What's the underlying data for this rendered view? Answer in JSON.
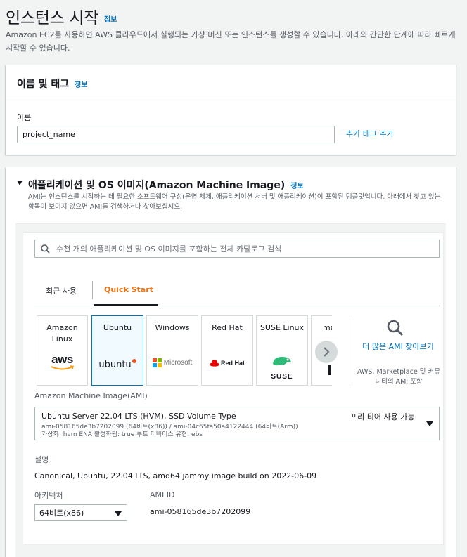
{
  "page": {
    "title": "인스턴스 시작",
    "info": "정보",
    "subtitle": "Amazon EC2를 사용하면 AWS 클라우드에서 실행되는 가상 머신 또는 인스턴스를 생성할 수 있습니다. 아래의 간단한 단계에 따라 빠르게 시작할 수 있습니다."
  },
  "name_tags": {
    "heading": "이름 및 태그",
    "info": "정보",
    "name_label": "이름",
    "name_value": "project_name",
    "add_tag_link": "추가 태그 추가"
  },
  "ami_section": {
    "heading": "애플리케이션 및 OS 이미지(Amazon Machine Image)",
    "info": "정보",
    "description": "AMI는 인스턴스를 시작하는 데 필요한 소프트웨어 구성(운영 체제, 애플리케이션 서버 및 애플리케이션)이 포함된 템플릿입니다. 아래에서 찾고 있는 항목이 보이지 않으면 AMI를 검색하거나 찾아보십시오.",
    "search_placeholder": "수천 개의 애플리케이션 및 OS 이미지를 포함하는 전체 카탈로그 검색",
    "tabs": [
      {
        "label": "최근 사용",
        "active": false
      },
      {
        "label": "Quick Start",
        "active": true
      }
    ],
    "tiles": [
      {
        "label": "Amazon\nLinux",
        "logo_text": "aws",
        "selected": false
      },
      {
        "label": "Ubuntu",
        "logo_text": "ubuntu",
        "selected": true
      },
      {
        "label": "Windows",
        "logo_text": "Microsoft",
        "selected": false
      },
      {
        "label": "Red Hat",
        "logo_text": "Red Hat",
        "selected": false
      },
      {
        "label": "SUSE Linux",
        "logo_text": "SUSE",
        "selected": false
      },
      {
        "label": "ma",
        "logo_text": "",
        "selected": false
      }
    ],
    "more_ami_link": "더 많은 AMI 찾아보기",
    "more_ami_note": "AWS, Marketplace 및 커뮤니티의 AMI 포함",
    "ami_label": "Amazon Machine Image(AMI)",
    "ami_selected": {
      "name": "Ubuntu Server 22.04 LTS (HVM), SSD Volume Type",
      "ids": "ami-058165de3b7202099 (64비트(x86)) / ami-04c65fa50a4122444 (64비트(Arm))",
      "virtualization": "가상화: hvm     ENA 활성화됨: true     루트 디바이스 유형: ebs",
      "tier": "프리 티어 사용 가능"
    },
    "description_label": "설명",
    "description_value": "Canonical, Ubuntu, 22.04 LTS, amd64 jammy image build on 2022-06-09",
    "arch_label": "아키텍처",
    "arch_value": "64비트(x86)",
    "ami_id_label": "AMI ID",
    "ami_id_value": "ami-058165de3b7202099"
  },
  "colors": {
    "link": "#0073bb",
    "accent_tab": "#ec7211",
    "selected_border": "#0073bb"
  }
}
